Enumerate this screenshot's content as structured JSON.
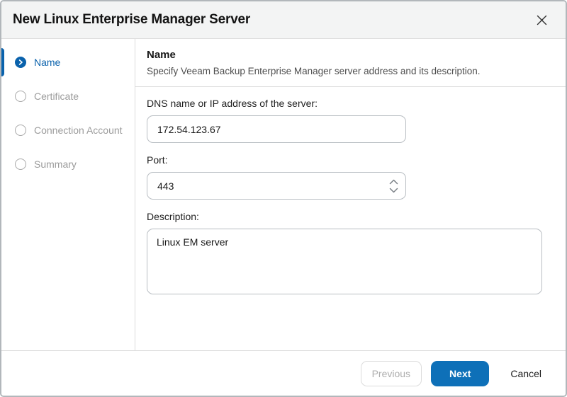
{
  "dialog": {
    "title": "New Linux Enterprise Manager Server"
  },
  "steps": [
    {
      "label": "Name",
      "state": "active"
    },
    {
      "label": "Certificate",
      "state": "pending"
    },
    {
      "label": "Connection Account",
      "state": "pending"
    },
    {
      "label": "Summary",
      "state": "pending"
    }
  ],
  "content": {
    "heading": "Name",
    "subtitle": "Specify Veeam Backup Enterprise Manager server address and its description.",
    "fields": {
      "dns": {
        "label": "DNS name or IP address of the server:",
        "value": "172.54.123.67"
      },
      "port": {
        "label": "Port:",
        "value": "443"
      },
      "description": {
        "label": "Description:",
        "value": "Linux EM server"
      }
    }
  },
  "footer": {
    "previous_label": "Previous",
    "next_label": "Next",
    "cancel_label": "Cancel"
  },
  "icons": {
    "close": "x-cross",
    "active_step": "chevron-right",
    "port_spinner_up": "chevron-up",
    "port_spinner_down": "chevron-down"
  },
  "colors": {
    "primary_button": "#0e70b8",
    "active_step_accent": "#0a62ac",
    "header_background": "#f3f4f4",
    "inactive_step_text": "#9b9b9b"
  }
}
